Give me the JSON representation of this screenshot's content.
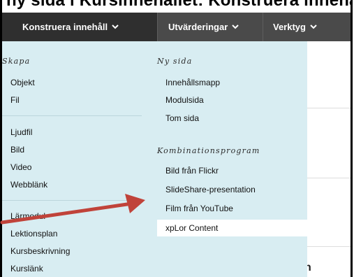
{
  "top_title": "ny sida i Kursinnehållet: Konstruera innehåll",
  "nav": {
    "tabs": [
      {
        "label": "Konstruera innehåll"
      },
      {
        "label": "Utvärderingar"
      },
      {
        "label": "Verktyg"
      }
    ]
  },
  "menu": {
    "left": {
      "heading": "Skapa",
      "items": [
        "Objekt",
        "Fil",
        "Ljudfil",
        "Bild",
        "Video",
        "Webblänk",
        "Lärmodul",
        "Lektionsplan",
        "Kursbeskrivning",
        "Kurslänk"
      ]
    },
    "right": {
      "heading_new_page": "Ny sida",
      "new_page_items": [
        "Innehållsmapp",
        "Modulsida",
        "Tom sida"
      ],
      "heading_mashups": "Kombinationsprogram",
      "mashup_items": [
        "Bild från Flickr",
        "SlideShare-presentation",
        "Film från YouTube",
        "xpLor Content"
      ]
    }
  },
  "colors": {
    "nav_bg": "#4a4a4a",
    "nav_active": "#2f2f2f",
    "menu_bg": "#d8edf2",
    "arrow": "#c0433a"
  },
  "annotation": {
    "icon": "red-arrow-icon"
  },
  "background_glyph": "n"
}
